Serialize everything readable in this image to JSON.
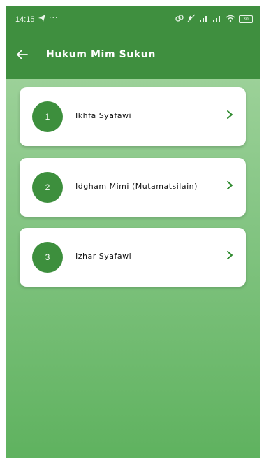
{
  "status_bar": {
    "time": "14:15",
    "dots": "···",
    "battery_level": "30",
    "icons": [
      "telegram-icon",
      "link-icon",
      "mute-icon",
      "signal-icon",
      "signal-icon-2",
      "wifi-icon",
      "battery-icon"
    ]
  },
  "toolbar": {
    "title": "Hukum Mim Sukun",
    "back_icon": "arrow-left-icon",
    "background_color": "#3f8f3f"
  },
  "items": [
    {
      "number": "1",
      "label": "Ikhfa Syafawi"
    },
    {
      "number": "2",
      "label": "Idgham Mimi (Mutamatsilain)"
    },
    {
      "number": "3",
      "label": "Izhar Syafawi"
    }
  ],
  "accent_color": "#3d8f3d"
}
